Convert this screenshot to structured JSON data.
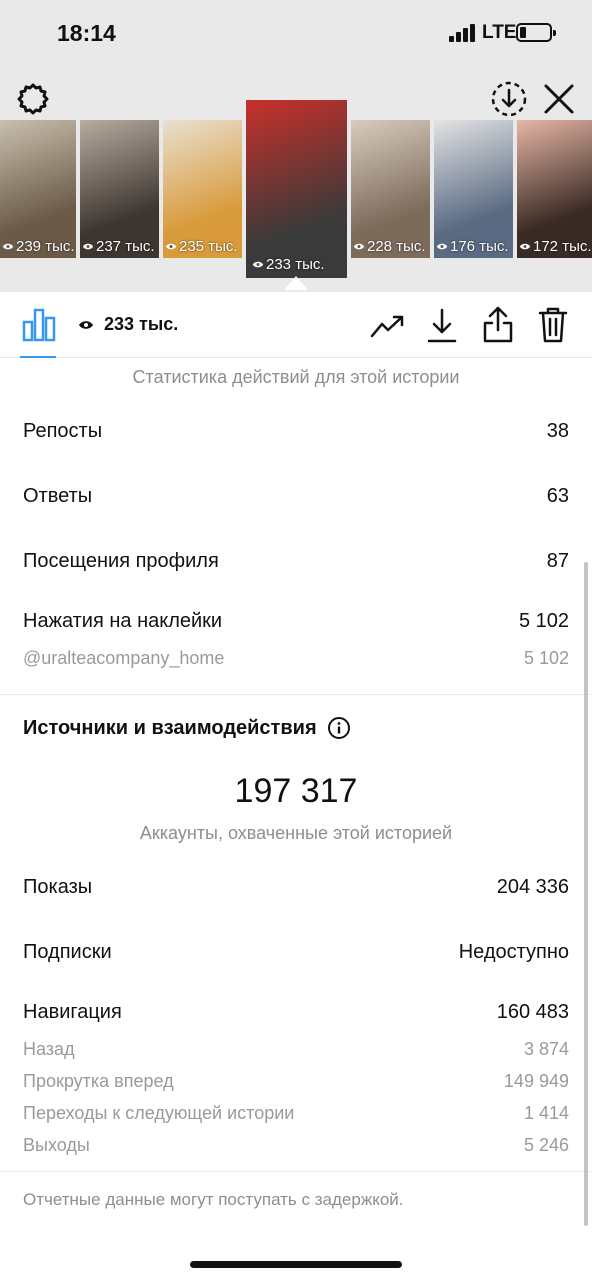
{
  "status": {
    "time": "18:14",
    "network": "LTE"
  },
  "toolbar": {
    "settings_icon": "gear-icon",
    "save_icon": "download-circle-icon",
    "close_icon": "close-icon"
  },
  "thumbnails": [
    {
      "views": "239 тыс.",
      "colors": [
        "#6b5a48",
        "#c9bfae"
      ]
    },
    {
      "views": "237 тыс.",
      "colors": [
        "#3d3530",
        "#b8aca0"
      ]
    },
    {
      "views": "235 тыс.",
      "colors": [
        "#d89a3a",
        "#e9e0d0"
      ]
    },
    {
      "views": "233 тыс.",
      "colors": [
        "#3a3a3a",
        "#c8302a"
      ],
      "selected": true
    },
    {
      "views": "228 тыс.",
      "colors": [
        "#7c6a5a",
        "#d8ccbf"
      ]
    },
    {
      "views": "176 тыс.",
      "colors": [
        "#596a82",
        "#e4e4e4"
      ]
    },
    {
      "views": "172 тыс.",
      "colors": [
        "#3a2a24",
        "#e6b6a6"
      ]
    }
  ],
  "action_bar": {
    "views": "233 тыс.",
    "accent": "#3897f0"
  },
  "interactions": {
    "caption": "Статистика действий для этой истории",
    "rows": [
      {
        "label": "Репосты",
        "value": "38"
      },
      {
        "label": "Ответы",
        "value": "63"
      },
      {
        "label": "Посещения профиля",
        "value": "87"
      },
      {
        "label": "Нажатия на наклейки",
        "value": "5 102"
      }
    ],
    "sticker": {
      "label": "@uralteacompany_home",
      "value": "5 102"
    }
  },
  "discovery": {
    "title": "Источники и взаимодействия",
    "reach": "197 317",
    "reach_caption": "Аккаунты, охваченные этой историей",
    "rows": [
      {
        "label": "Показы",
        "value": "204 336"
      },
      {
        "label": "Подписки",
        "value": "Недоступно"
      },
      {
        "label": "Навигация",
        "value": "160 483"
      }
    ],
    "navigation": [
      {
        "label": "Назад",
        "value": "3 874"
      },
      {
        "label": "Прокрутка вперед",
        "value": "149 949"
      },
      {
        "label": "Переходы к следующей истории",
        "value": "1 414"
      },
      {
        "label": "Выходы",
        "value": "5 246"
      }
    ]
  },
  "footer_note": "Отчетные данные могут поступать с задержкой."
}
